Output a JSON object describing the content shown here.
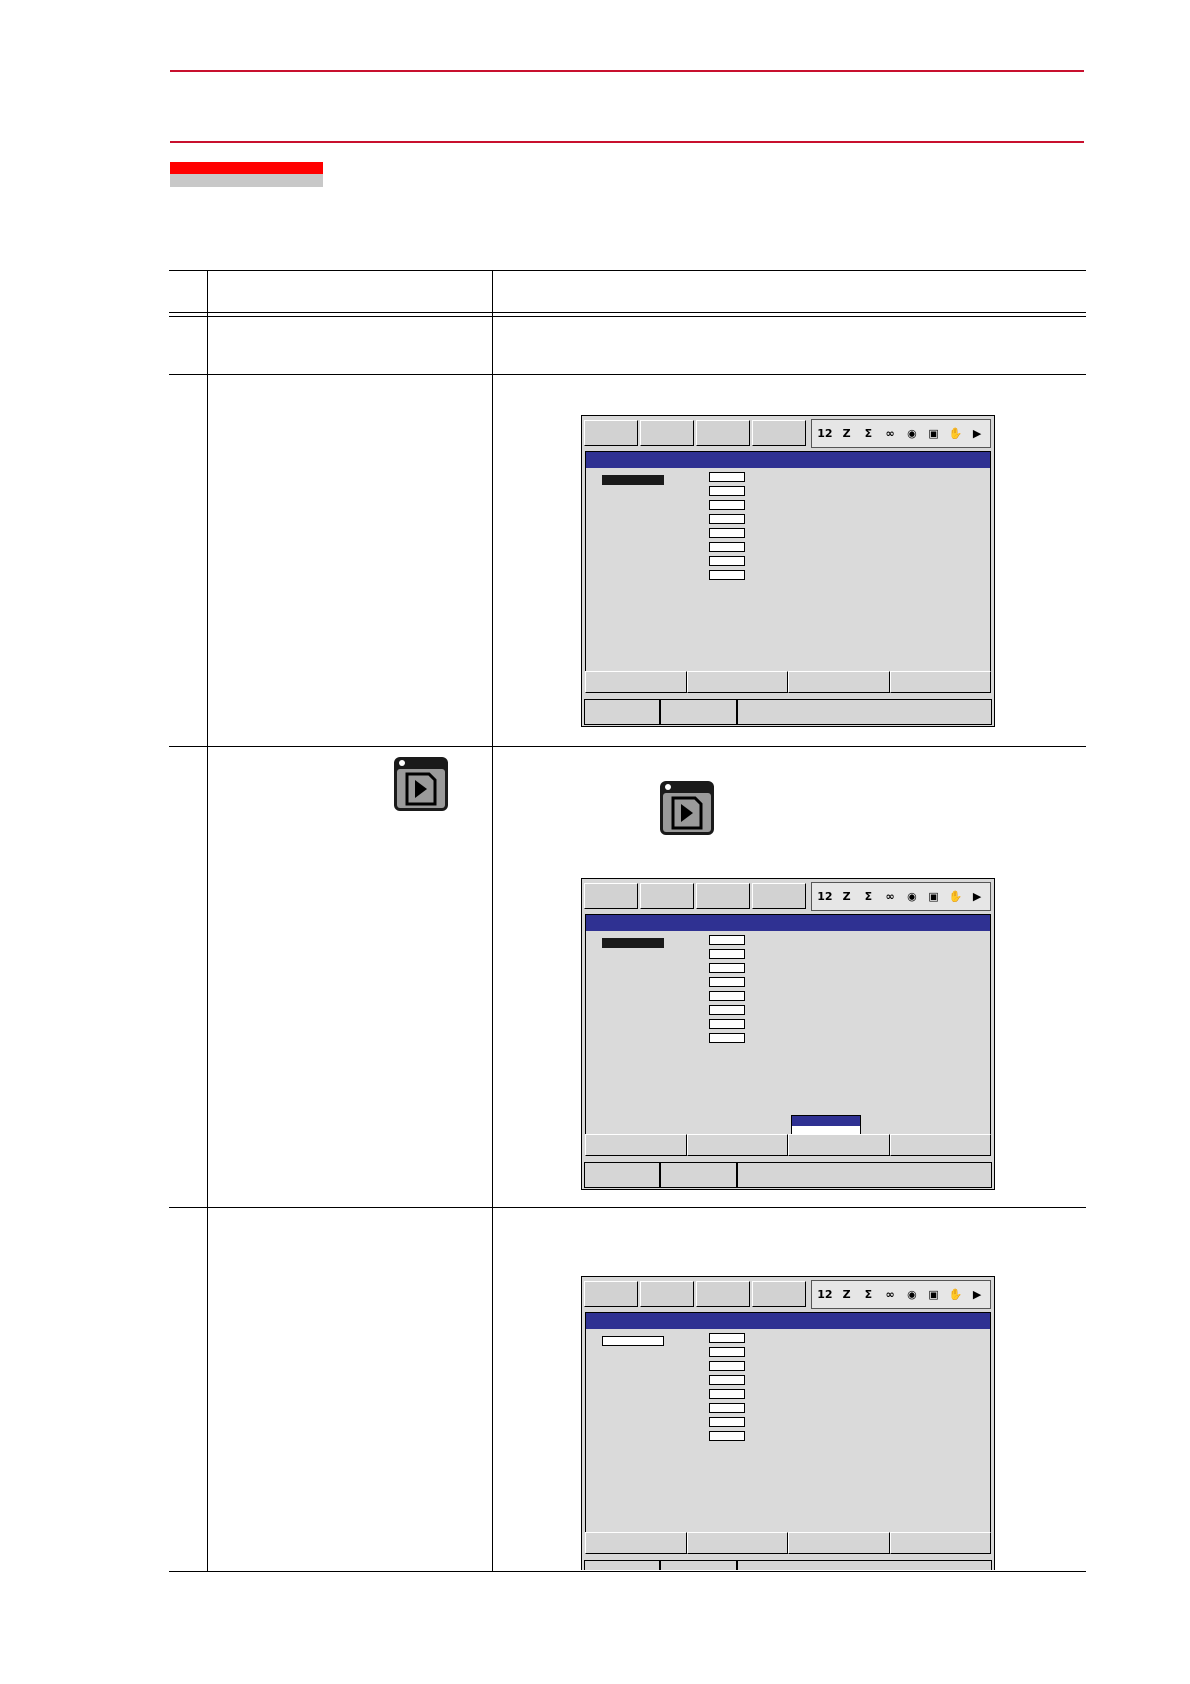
{
  "document": {
    "header_text": "",
    "section_tag": "",
    "table": {
      "columns": [
        "",
        "",
        ""
      ],
      "rows": [
        {
          "step": "",
          "operation": "",
          "explanation": ""
        },
        {
          "step": "",
          "operation": "",
          "explanation": ""
        },
        {
          "step": "",
          "operation": "",
          "explanation": "",
          "key": "area-key-icon"
        },
        {
          "step": "",
          "operation": "",
          "explanation": ""
        }
      ]
    }
  },
  "screens": [
    {
      "name": "screen-1",
      "menu_highlight": "filled",
      "popup": false
    },
    {
      "name": "screen-2",
      "menu_highlight": "filled",
      "popup": true
    },
    {
      "name": "screen-3",
      "menu_highlight": "outline",
      "popup": false
    }
  ],
  "status_icons": [
    "12",
    "Z",
    "Σ",
    "∞",
    "◉",
    "▣",
    "✋",
    "▶"
  ],
  "colors": {
    "rule_red": "#c8102e",
    "tag_red": "#ff0000",
    "tag_gray": "#c8c8c8",
    "title_bar": "#2f3192",
    "screen_bg": "#d8d8d8"
  }
}
